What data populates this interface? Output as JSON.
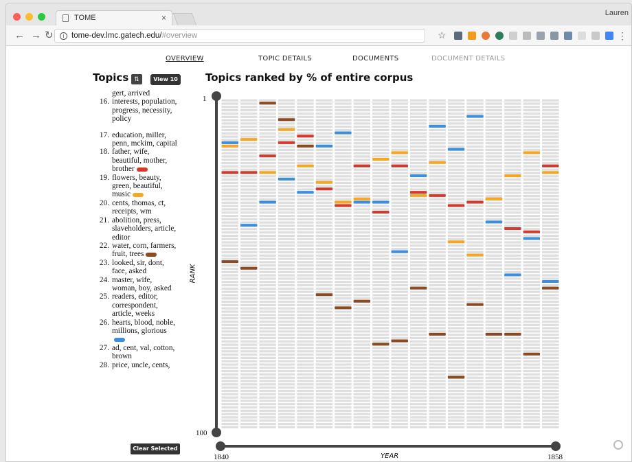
{
  "browser": {
    "tab_title": "TOME",
    "tab_close": "×",
    "user": "Lauren",
    "url_main": "tome-dev.lmc.gatech.edu/",
    "url_hash": "#overview"
  },
  "nav": {
    "items": [
      "OVERVIEW",
      "TOPIC DETAILS",
      "DOCUMENTS",
      "DOCUMENT DETAILS"
    ],
    "active": "OVERVIEW"
  },
  "sidebar": {
    "title": "Topics",
    "view_button": "View 10",
    "clear_button": "Clear Selected",
    "topics": [
      {
        "num": "",
        "words": "gert, arrived",
        "color": null
      },
      {
        "num": "16.",
        "words": "interests, population, progress, necessity, policy",
        "color": null
      },
      {
        "num": "17.",
        "words": "education, miller, penn, mckim, capital",
        "color": null
      },
      {
        "num": "18.",
        "words": "father, wife, beautiful, mother, brother",
        "color": "#d23a2e"
      },
      {
        "num": "19.",
        "words": "flowers, beauty, green, beautiful, music",
        "color": "#f5a623"
      },
      {
        "num": "20.",
        "words": "cents, thomas, ct, receipts, wm",
        "color": null
      },
      {
        "num": "21.",
        "words": "abolition, press, slaveholders, article, editor",
        "color": null
      },
      {
        "num": "22.",
        "words": "water, corn, farmers, fruit, trees",
        "color": "#8b4a22"
      },
      {
        "num": "23.",
        "words": "looked, sir, dont, face, asked",
        "color": null
      },
      {
        "num": "24.",
        "words": "master, wife, woman, boy, asked",
        "color": null
      },
      {
        "num": "25.",
        "words": "readers, editor, correspondent, article, weeks",
        "color": null
      },
      {
        "num": "26.",
        "words": "hearts, blood, noble, millions, glorious",
        "color": "#3b8fdd"
      },
      {
        "num": "27.",
        "words": "ad, cent, val, cotton, brown",
        "color": null
      },
      {
        "num": "28.",
        "words": "price, uncle, cents,",
        "color": null
      }
    ]
  },
  "chart_title": "Topics ranked by % of entire corpus",
  "chart_data": {
    "type": "heatmap",
    "title": "Topics ranked by % of entire corpus",
    "xlabel": "YEAR",
    "ylabel": "RANK",
    "x_range": [
      1840,
      1858
    ],
    "y_range": [
      1,
      100
    ],
    "y_tick_labels": [
      "1",
      "100"
    ],
    "x_tick_labels": [
      "1840",
      "1858"
    ],
    "colors": {
      "red": "#d23a2e",
      "orange": "#f5a623",
      "brown": "#8b4a22",
      "blue": "#3b8fdd"
    },
    "series": [
      {
        "name": "18",
        "color": "red",
        "points": [
          [
            1840,
            23
          ],
          [
            1841,
            23
          ],
          [
            1842,
            18
          ],
          [
            1843,
            14
          ],
          [
            1844,
            12
          ],
          [
            1845,
            28
          ],
          [
            1846,
            33
          ],
          [
            1847,
            21
          ],
          [
            1848,
            35
          ],
          [
            1849,
            21
          ],
          [
            1850,
            29
          ],
          [
            1851,
            30
          ],
          [
            1852,
            33
          ],
          [
            1853,
            32
          ],
          [
            1854,
            31
          ],
          [
            1855,
            40
          ],
          [
            1856,
            41
          ],
          [
            1857,
            21
          ]
        ]
      },
      {
        "name": "19",
        "color": "orange",
        "points": [
          [
            1840,
            15
          ],
          [
            1841,
            13
          ],
          [
            1842,
            23
          ],
          [
            1843,
            10
          ],
          [
            1844,
            21
          ],
          [
            1845,
            26
          ],
          [
            1846,
            32
          ],
          [
            1847,
            31
          ],
          [
            1848,
            19
          ],
          [
            1849,
            17
          ],
          [
            1850,
            30
          ],
          [
            1851,
            20
          ],
          [
            1852,
            44
          ],
          [
            1853,
            48
          ],
          [
            1854,
            31
          ],
          [
            1855,
            24
          ],
          [
            1856,
            17
          ],
          [
            1857,
            23
          ]
        ]
      },
      {
        "name": "22",
        "color": "brown",
        "points": [
          [
            1840,
            50
          ],
          [
            1841,
            52
          ],
          [
            1842,
            2
          ],
          [
            1843,
            7
          ],
          [
            1844,
            15
          ],
          [
            1845,
            60
          ],
          [
            1846,
            64
          ],
          [
            1847,
            62
          ],
          [
            1848,
            75
          ],
          [
            1849,
            74
          ],
          [
            1850,
            58
          ],
          [
            1851,
            72
          ],
          [
            1852,
            85
          ],
          [
            1853,
            63
          ],
          [
            1854,
            72
          ],
          [
            1855,
            72
          ],
          [
            1856,
            78
          ],
          [
            1857,
            58
          ]
        ]
      },
      {
        "name": "26",
        "color": "blue",
        "points": [
          [
            1840,
            14
          ],
          [
            1841,
            39
          ],
          [
            1842,
            32
          ],
          [
            1843,
            25
          ],
          [
            1844,
            29
          ],
          [
            1845,
            15
          ],
          [
            1846,
            11
          ],
          [
            1847,
            32
          ],
          [
            1848,
            32
          ],
          [
            1849,
            47
          ],
          [
            1850,
            24
          ],
          [
            1851,
            9
          ],
          [
            1852,
            16
          ],
          [
            1853,
            6
          ],
          [
            1854,
            38
          ],
          [
            1855,
            54
          ],
          [
            1856,
            43
          ],
          [
            1857,
            56
          ]
        ]
      }
    ]
  }
}
